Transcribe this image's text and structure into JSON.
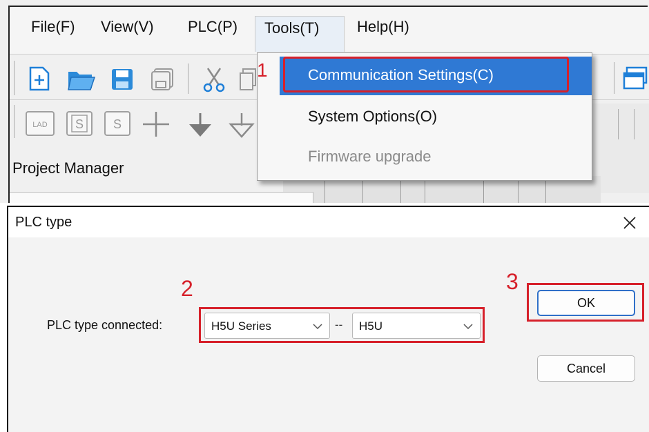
{
  "menubar": {
    "items": [
      "File(F)",
      "View(V)",
      "PLC(P)",
      "Tools(T)",
      "Help(H)"
    ]
  },
  "panels": {
    "project_manager_label": "Project Manager"
  },
  "dropdown": {
    "items": [
      {
        "label": "Communication Settings(C)",
        "state": "highlighted"
      },
      {
        "label": "System Options(O)",
        "state": "enabled"
      },
      {
        "label": "Firmware upgrade",
        "state": "disabled"
      }
    ]
  },
  "dialog": {
    "title": "PLC type",
    "field_label": "PLC type connected:",
    "series_select": {
      "value": "H5U Series"
    },
    "separator": "--",
    "model_select": {
      "value": "H5U"
    },
    "ok_label": "OK",
    "cancel_label": "Cancel"
  },
  "annotations": {
    "step1": "1",
    "step2": "2",
    "step3": "3"
  },
  "colors": {
    "highlight_blue": "#2f79d4",
    "annotation_red": "#d6202a",
    "ok_border_blue": "#2f6fc8"
  },
  "toolbar_icons": {
    "row1": [
      "new-file-icon",
      "open-folder-icon",
      "save-icon",
      "save-all-icon",
      "cut-icon",
      "copy-icon"
    ],
    "row2": [
      "ladder-icon",
      "sfc-icon",
      "st-icon",
      "contact-cross-icon",
      "arrow-down-icon",
      "arrow-down-outline-icon"
    ],
    "right": [
      "window-icon"
    ]
  }
}
